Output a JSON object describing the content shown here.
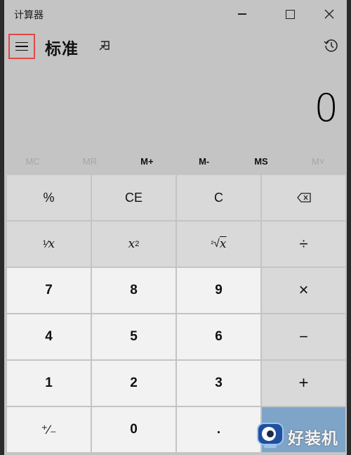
{
  "window": {
    "title": "计算器",
    "minimize_label": "",
    "maximize_label": "",
    "close_label": ""
  },
  "header": {
    "mode_title": "标准",
    "menu_icon": "hamburger-icon",
    "keep_on_top_icon": "keep-on-top-icon",
    "history_icon": "history-icon"
  },
  "display": {
    "value": "0"
  },
  "memory": [
    {
      "label": "MC",
      "enabled": false
    },
    {
      "label": "MR",
      "enabled": false
    },
    {
      "label": "M+",
      "enabled": true
    },
    {
      "label": "M-",
      "enabled": true
    },
    {
      "label": "MS",
      "enabled": true
    },
    {
      "label": "M˅",
      "enabled": false
    }
  ],
  "keys": {
    "percent": "%",
    "ce": "CE",
    "c": "C",
    "backspace_icon": "backspace-icon",
    "reciprocal_num": "¹⁄",
    "reciprocal_x": "x",
    "square_x": "x",
    "square_exp": "2",
    "sqrt_idx": "²",
    "sqrt_sym": "√",
    "sqrt_x": "x",
    "divide": "÷",
    "k7": "7",
    "k8": "8",
    "k9": "9",
    "multiply": "×",
    "k4": "4",
    "k5": "5",
    "k6": "6",
    "minus": "−",
    "k1": "1",
    "k2": "2",
    "k3": "3",
    "plus": "+",
    "negate": "⁺∕₋",
    "k0": "0",
    "decimal": ".",
    "equals": "="
  },
  "watermark": {
    "text": "好装机"
  },
  "colors": {
    "highlight_border": "#e04848",
    "equals_bg": "#7ea4c8"
  }
}
